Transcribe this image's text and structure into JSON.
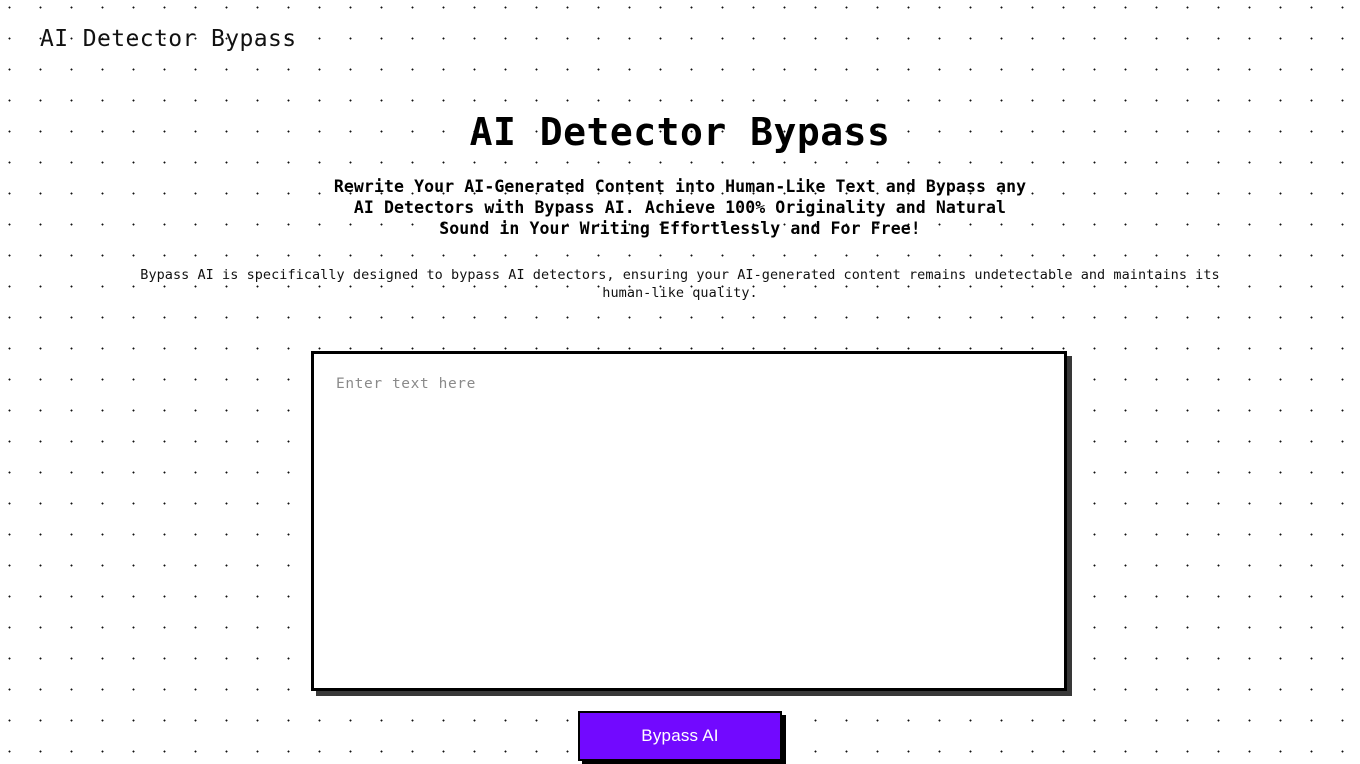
{
  "nav": {
    "brand": "AI Detector Bypass"
  },
  "hero": {
    "title": "AI Detector Bypass",
    "subtitle": "Rewrite Your AI-Generated Content into Human-Like Text and Bypass any AI Detectors with Bypass AI. Achieve 100% Originality and Natural Sound in Your Writing Effortlessly and For Free!",
    "description": "Bypass AI is specifically designed to bypass AI detectors, ensuring your AI-generated content remains undetectable and maintains its human-like quality."
  },
  "editor": {
    "placeholder": "Enter text here",
    "value": ""
  },
  "actions": {
    "submit_label": "Bypass AI"
  },
  "colors": {
    "accent": "#7209FF",
    "border": "#000000",
    "background": "#FFFFFF",
    "dot": "#111111",
    "placeholder": "#8A8A8A"
  }
}
